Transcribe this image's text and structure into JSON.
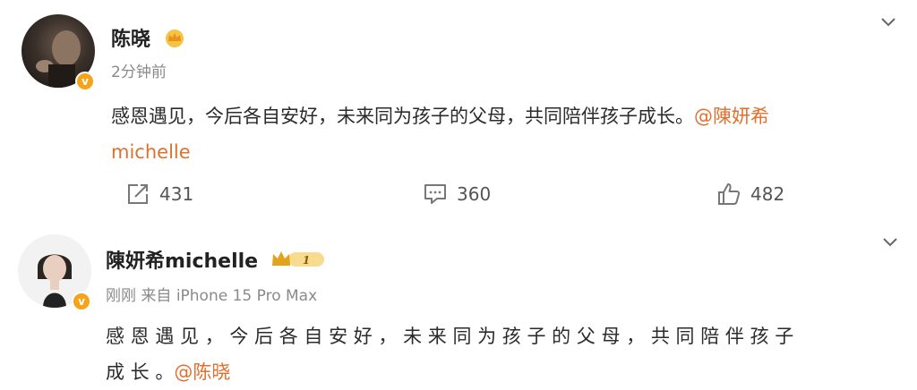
{
  "post1": {
    "user_name": "陈晓",
    "timestamp": "2分钟前",
    "text": "感恩遇见，今后各自安好，未来同为孩子的父母，共同陪伴孩子成长。",
    "mention_line1": "@陳妍希",
    "mention_line2": "michelle",
    "actions": {
      "repost_count": "431",
      "comment_count": "360",
      "like_count": "482"
    }
  },
  "post2": {
    "user_name": "陳妍希michelle",
    "timestamp": "刚刚",
    "source_prefix": "来自",
    "device": "iPhone 15 Pro Max",
    "text_line1": "感 恩 遇 见 ， 今 后 各 自 安 好 ， 未 来 同 为 孩 子 的 父 母 ， 共 同 陪 伴 孩 子",
    "text_line2": "成 长 。",
    "mention": "@陈晓",
    "vip_level": "1"
  },
  "icons": {
    "chevron": "chevron-down-icon",
    "verified": "verified-badge-icon",
    "crown": "vip-crown-icon",
    "repost": "repost-icon",
    "comment": "comment-icon",
    "like": "thumbs-up-icon"
  },
  "colors": {
    "accent": "#e0702e",
    "verified": "#f4a31b",
    "muted": "#8a8a8a"
  }
}
